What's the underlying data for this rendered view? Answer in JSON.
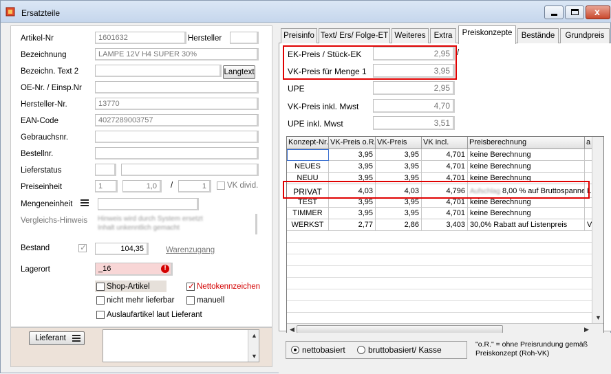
{
  "window": {
    "title": "Ersatzteile"
  },
  "left": {
    "artikel_nr": {
      "label": "Artikel-Nr",
      "value": "1601632"
    },
    "hersteller_label": "Hersteller",
    "bezeichnung": {
      "label": "Bezeichnung",
      "value": "LAMPE 12V H4 SUPER 30%"
    },
    "bezeichnung2": {
      "label": "Bezeichn. Text 2",
      "value": "",
      "button": "Langtext"
    },
    "oe_nr": {
      "label": "OE-Nr. / Einsp.Nr",
      "value": ""
    },
    "hersteller_nr": {
      "label": "Hersteller-Nr.",
      "value": "13770"
    },
    "ean": {
      "label": "EAN-Code",
      "value": "4027289003757"
    },
    "gebrauchsnr": {
      "label": "Gebrauchsnr.",
      "value": ""
    },
    "bestellnr": {
      "label": "Bestellnr.",
      "value": ""
    },
    "lieferstatus": {
      "label": "Lieferstatus",
      "value": ""
    },
    "preiseinheit": {
      "label": "Preiseinheit",
      "v1": "1",
      "v2": "1,0",
      "slash": "/",
      "v3": "1",
      "vk_divid": "VK divid."
    },
    "mengeneinheit": {
      "label": "Mengeneinheit",
      "value": ""
    },
    "vergleich": {
      "label": "Vergleichs-Hinweis",
      "line1": "Hinweis wird durch System ersetzt",
      "line2": "Inhalt unkenntlich gemacht"
    },
    "bestand": {
      "label": "Bestand",
      "value": "104,35",
      "warenzugang": "Warenzugang"
    },
    "lagerort": {
      "label": "Lagerort",
      "value": "_16"
    },
    "checkboxes": {
      "shop": "Shop-Artikel",
      "netto": "Nettokennzeichen",
      "nicht_lieferbar": "nicht mehr lieferbar",
      "manuell": "manuell",
      "auslauf": "Auslaufartikel laut Lieferant"
    },
    "lieferant_button": "Lieferant"
  },
  "tabs": [
    "Preisinfo",
    "Text/ Ers/ Folge-ET",
    "Weiteres",
    "Extra",
    "Preiskonzepte",
    "Bestände",
    "Grundpreis"
  ],
  "prices": {
    "ek": {
      "label": "EK-Preis  / Stück-EK",
      "value": "2,95"
    },
    "vk_menge": {
      "label": "VK-Preis für Menge 1",
      "value": "3,95"
    },
    "upe": {
      "label": "UPE",
      "value": "2,95"
    },
    "vk_mwst": {
      "label": "VK-Preis inkl. Mwst",
      "value": "4,70"
    },
    "upe_mwst": {
      "label": "UPE inkl. Mwst",
      "value": "3,51"
    },
    "slash": "/"
  },
  "grid": {
    "headers": [
      "Konzept-Nr.",
      "VK-Preis o.R.",
      "VK-Preis",
      "VK incl.",
      "Preisberechnung",
      "a"
    ],
    "rows": [
      [
        "",
        "3,95",
        "3,95",
        "4,701",
        "keine Berechnung",
        ""
      ],
      [
        "NEUES",
        "3,95",
        "3,95",
        "4,701",
        "keine Berechnung",
        ""
      ],
      [
        "NEUU",
        "3,95",
        "3,95",
        "4,701",
        "keine Berechnung",
        ""
      ],
      [
        "PRIVAT",
        "4,03",
        "4,03",
        "4,796",
        "8,00 % auf Bruttospanne",
        "L"
      ],
      [
        "TEST",
        "3,95",
        "3,95",
        "4,701",
        "keine Berechnung",
        ""
      ],
      [
        "TIMMER",
        "3,95",
        "3,95",
        "4,701",
        "keine Berechnung",
        ""
      ],
      [
        "WERKST",
        "2,77",
        "2,86",
        "3,403",
        "30,0% Rabatt auf Listenpreis",
        "V"
      ]
    ],
    "privat_prefix_blurred": "Aufschlag"
  },
  "radio": {
    "netto": "nettobasiert",
    "brutto": "bruttobasiert/ Kasse"
  },
  "note": {
    "line1": "\"o.R.\" = ohne Preisrundung gemäß",
    "line2": "Preiskonzept (Roh-VK)"
  }
}
